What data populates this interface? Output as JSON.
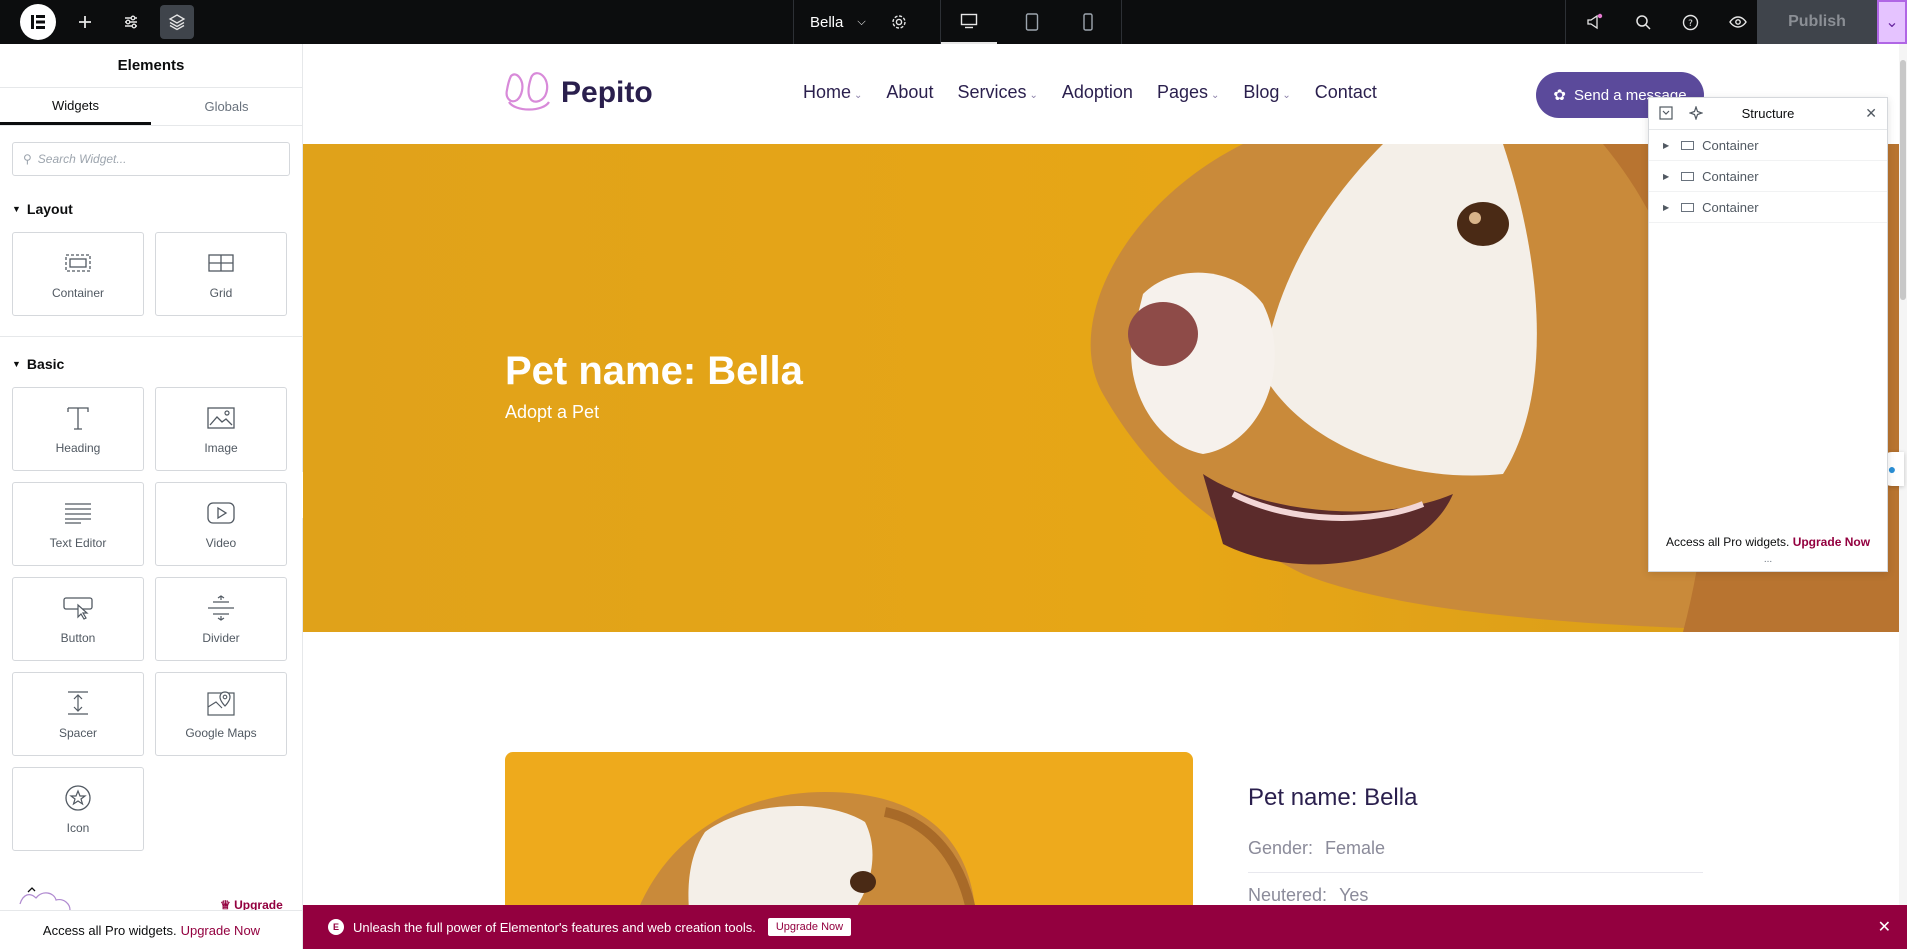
{
  "topbar": {
    "document_name": "Bella",
    "publish_label": "Publish"
  },
  "panel": {
    "title": "Elements",
    "tabs": [
      "Widgets",
      "Globals"
    ],
    "search_placeholder": "Search Widget...",
    "sections": {
      "layout": {
        "title": "Layout",
        "widgets": [
          "Container",
          "Grid"
        ]
      },
      "basic": {
        "title": "Basic",
        "widgets": [
          "Heading",
          "Image",
          "Text Editor",
          "Video",
          "Button",
          "Divider",
          "Spacer",
          "Google Maps",
          "Icon"
        ]
      }
    },
    "upgrade_label": "Upgrade",
    "promo_text": "Access all Pro widgets.",
    "promo_link": "Upgrade Now"
  },
  "site": {
    "brand": "Pepito",
    "nav": [
      {
        "label": "Home",
        "dropdown": true
      },
      {
        "label": "About",
        "dropdown": false
      },
      {
        "label": "Services",
        "dropdown": true
      },
      {
        "label": "Adoption",
        "dropdown": false
      },
      {
        "label": "Pages",
        "dropdown": true
      },
      {
        "label": "Blog",
        "dropdown": true
      },
      {
        "label": "Contact",
        "dropdown": false
      }
    ],
    "cta_label": "Send a message",
    "hero_title": "Pet name: Bella",
    "hero_subtitle": "Adopt a Pet",
    "info_title": "Pet name: Bella",
    "info": [
      {
        "label": "Gender:",
        "value": "Female"
      },
      {
        "label": "Neutered:",
        "value": "Yes"
      }
    ],
    "colors": {
      "hero": "#e7a616",
      "brand": "#2a1f4d",
      "cta": "#5b4a9b"
    }
  },
  "structure": {
    "title": "Structure",
    "items": [
      "Container",
      "Container",
      "Container"
    ],
    "footer_text": "Access all Pro widgets.",
    "footer_link": "Upgrade Now",
    "dots": "..."
  },
  "notice": {
    "text": "Unleash the full power of Elementor's features and web creation tools.",
    "button": "Upgrade Now"
  }
}
